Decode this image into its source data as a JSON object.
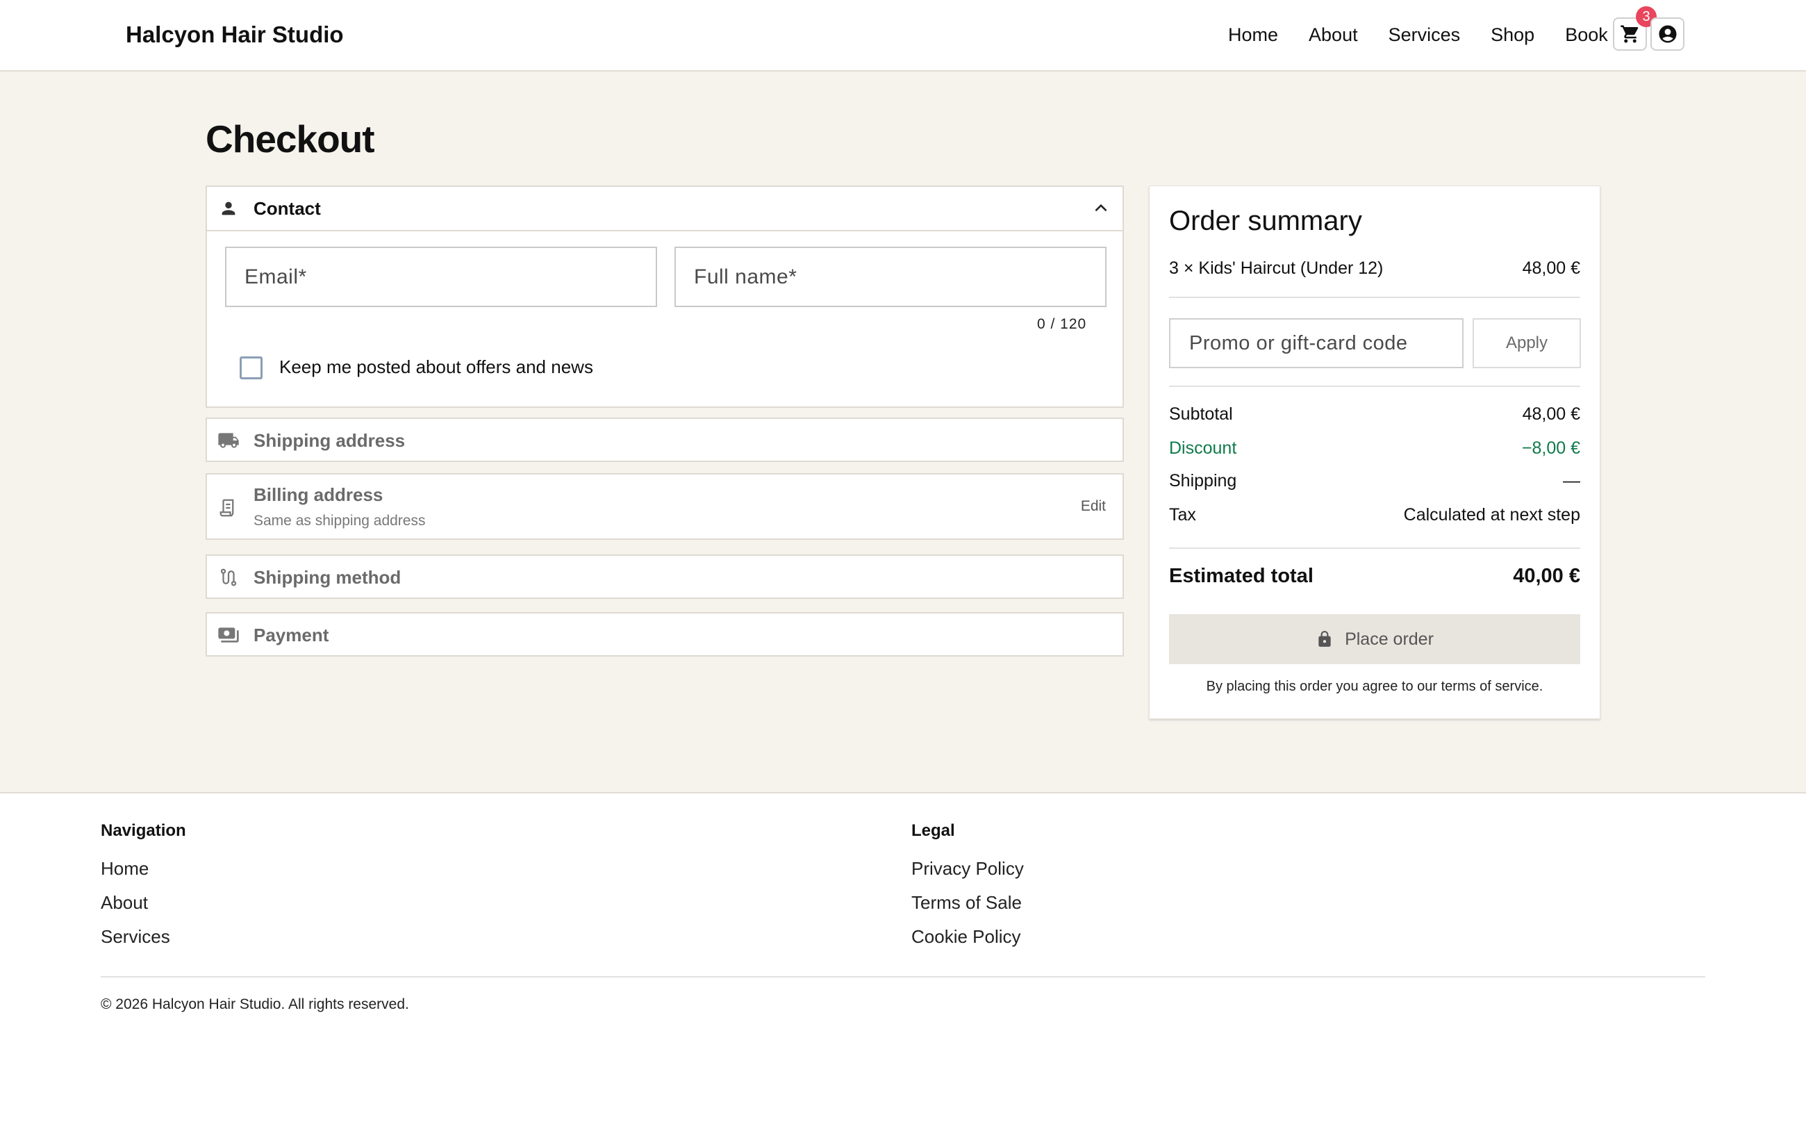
{
  "header": {
    "brand": "Halcyon Hair Studio",
    "nav": [
      "Home",
      "About",
      "Services",
      "Shop",
      "Book"
    ],
    "cart_count": "3",
    "cart_icon": "cart-icon",
    "account_icon": "account-icon"
  },
  "page": {
    "title": "Checkout"
  },
  "contact": {
    "title": "Contact",
    "email_placeholder": "Email*",
    "name_placeholder": "Full name*",
    "email_value": "",
    "name_value": "",
    "counter": "0 / 120",
    "newsletter_label": "Keep me posted about offers and news",
    "newsletter_checked": false
  },
  "steps": {
    "shipping_address": "Shipping address",
    "billing_address": "Billing address",
    "billing_sub": "Same as shipping address",
    "billing_edit": "Edit",
    "shipping_method": "Shipping method",
    "payment": "Payment"
  },
  "summary": {
    "title": "Order summary",
    "item_label": "3 × Kids' Haircut (Under 12)",
    "item_price": "48,00 €",
    "promo_placeholder": "Promo or gift-card code",
    "apply_label": "Apply",
    "subtotal_label": "Subtotal",
    "subtotal_value": "48,00 €",
    "discount_label": "Discount",
    "discount_value": "−8,00 €",
    "shipping_label": "Shipping",
    "shipping_value": "—",
    "tax_label": "Tax",
    "tax_value": "Calculated at next step",
    "total_label": "Estimated total",
    "total_value": "40,00 €",
    "place_order_label": "Place order",
    "terms": "By placing this order you agree to our terms of service."
  },
  "footer": {
    "navigation_heading": "Navigation",
    "navigation_links": [
      "Home",
      "About",
      "Services"
    ],
    "legal_heading": "Legal",
    "legal_links": [
      "Privacy Policy",
      "Terms of Sale",
      "Cookie Policy"
    ],
    "copyright": "© 2026 Halcyon Hair Studio. All rights reserved."
  },
  "colors": {
    "page_background": "#f6f3ed",
    "badge": "#e9455d",
    "discount": "#0f7a4a",
    "place_order_bg": "#e8e5de"
  }
}
